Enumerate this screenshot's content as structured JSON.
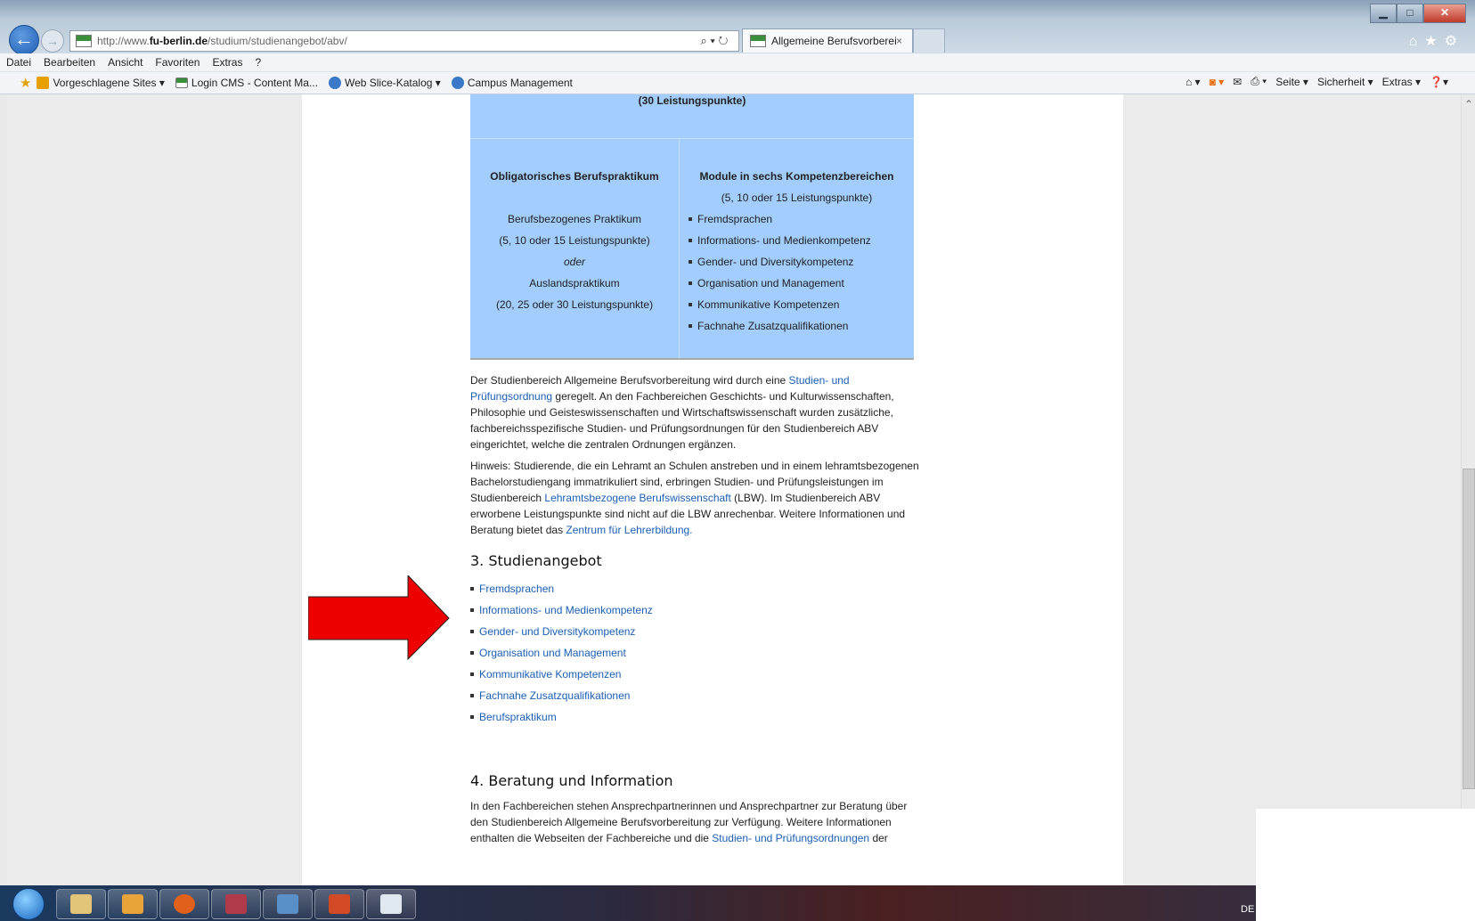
{
  "browser": {
    "url_prefix": "http://www.",
    "url_domain": "fu-berlin.de",
    "url_path": "/studium/studienangebot/abv/",
    "address_tools": "⌕ ▾ ↻",
    "tab_title": "Allgemeine Berufsvorbereit...",
    "tab_close": "×",
    "window_min": "▁",
    "window_max": "□",
    "window_close": "✕",
    "right_icons": "⌂★⚙"
  },
  "menu": [
    "Datei",
    "Bearbeiten",
    "Ansicht",
    "Favoriten",
    "Extras",
    "?"
  ],
  "favorites": [
    {
      "label": "Vorgeschlagene Sites ▾"
    },
    {
      "label": "Login CMS - Content Ma..."
    },
    {
      "label": "Web Slice-Katalog ▾"
    },
    {
      "label": "Campus Management"
    }
  ],
  "command_bar": [
    "Seite ▾",
    "Sicherheit ▾",
    "Extras ▾",
    "❓▾"
  ],
  "table": {
    "head": "(30 Leistungspunkte)",
    "left": {
      "title": "Obligatorisches Berufspraktikum",
      "line1": "Berufsbezogenes Praktikum",
      "line2": "(5, 10 oder 15 Leistungspunkte)",
      "line3": "oder",
      "line4": "Auslandspraktikum",
      "line5": "(20, 25 oder 30 Leistungspunkte)"
    },
    "right": {
      "title": "Module in sechs Kompetenzbereichen",
      "sub": "(5, 10 oder 15 Leistungspunkte)",
      "items": [
        "Fremdsprachen",
        "Informations- und Medienkompetenz",
        "Gender- und Diversitykompetenz",
        "Organisation und Management",
        "Kommunikative Kompetenzen",
        "Fachnahe Zusatzqualifikationen"
      ]
    }
  },
  "para1": {
    "t1": "Der Studienbereich Allgemeine Berufsvorbereitung wird durch eine ",
    "link": "Studien- und Prüfungsordnung",
    "t2": " geregelt. An den Fachbereichen Geschichts- und Kulturwissenschaften, Philosophie und Geisteswissenschaften und Wirtschaftswissenschaft wurden zusätzliche, fachbereichsspezifische Studien- und Prüfungsordnungen für den Studienbereich ABV eingerichtet, welche die zentralen Ordnungen ergänzen."
  },
  "para2": {
    "t1": "Hinweis: Studierende, die ein Lehramt an Schulen anstreben und in einem lehramtsbezogenen Bachelorstudiengang immatrikuliert sind, erbringen Studien- und Prüfungsleistungen im Studienbereich ",
    "link1": "Lehramtsbezogene Berufswissenschaft",
    "t2": " (LBW). Im Studienbereich ABV erworbene Leistungspunkte sind nicht auf die LBW anrechenbar. Weitere Informationen und Beratung bietet das ",
    "link2": "Zentrum für Lehrerbildung."
  },
  "section3": {
    "heading": "3. Studienangebot",
    "links": [
      "Fremdsprachen",
      "Informations- und Medienkompetenz",
      "Gender- und Diversitykompetenz",
      "Organisation und Management",
      "Kommunikative Kompetenzen",
      "Fachnahe Zusatzqualifikationen",
      "Berufspraktikum"
    ]
  },
  "section4": {
    "heading": "4. Beratung und Information",
    "t1": "In den Fachbereichen stehen Ansprechpartnerinnen und Ansprechpartner zur Beratung über den Studienbereich Allgemeine Berufsvorbereitung zur Verfügung. Weitere Informationen enthalten die Webseiten der Fachbereiche und die ",
    "link": "Studien- und Prüfungsordnungen",
    "t2": " der"
  },
  "taskbar": {
    "tray_lang": "DE"
  },
  "colors": {
    "table_bg": "#a2cdfc",
    "link": "#1a5fb4",
    "arrow": "#ee0000"
  }
}
